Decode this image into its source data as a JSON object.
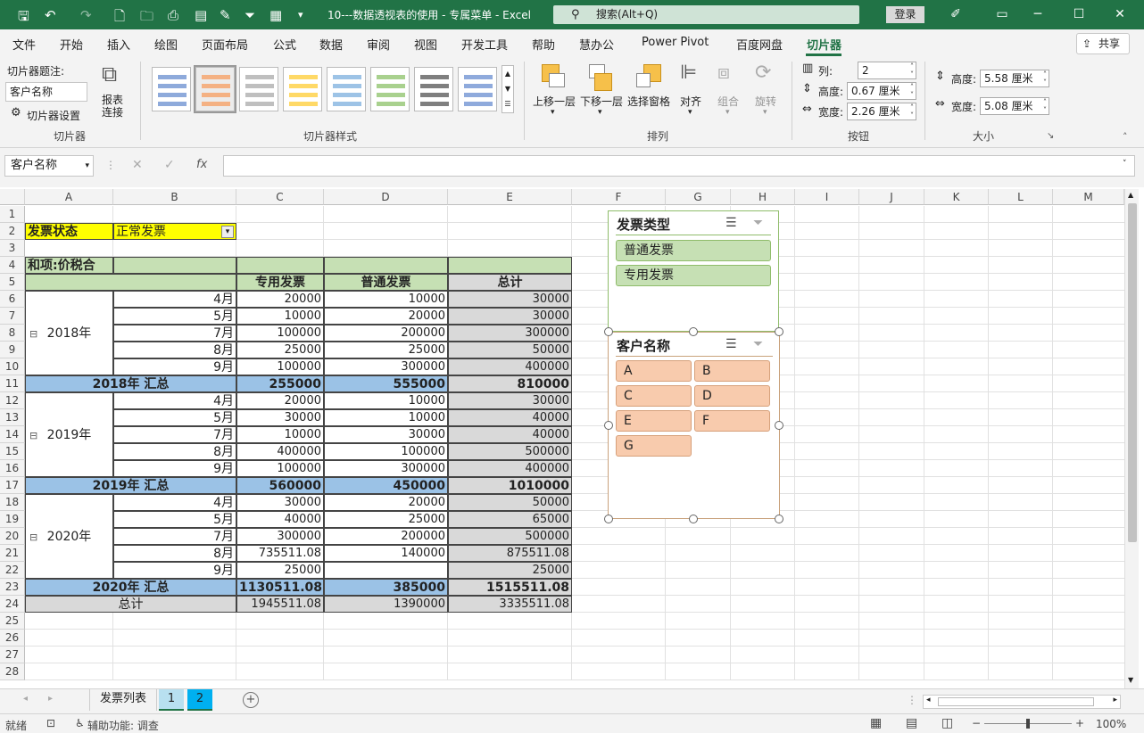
{
  "titlebar": {
    "doc_title": "10---数据透视表的使用 - 专属菜单  -  Excel",
    "search_placeholder": "搜索(Alt+Q)",
    "login": "登录"
  },
  "menu": {
    "tabs": [
      "文件",
      "开始",
      "插入",
      "绘图",
      "页面布局",
      "公式",
      "数据",
      "审阅",
      "视图",
      "开发工具",
      "帮助",
      "慧办公",
      "Power Pivot",
      "百度网盘",
      "切片器"
    ],
    "active_tab": "切片器",
    "share": "共享"
  },
  "ribbon": {
    "caption_label": "切片器题注:",
    "caption_value": "客户名称",
    "settings": "切片器设置",
    "report_link": "报表\n连接",
    "group_slicer": "切片器",
    "group_styles": "切片器样式",
    "bring_forward": "上移一层",
    "send_backward": "下移一层",
    "selection_pane": "选择窗格",
    "align": "对齐",
    "group": "组合",
    "rotate": "旋转",
    "group_arrange": "排列",
    "columns_label": "列:",
    "columns_value": "2",
    "btn_height_label": "高度:",
    "btn_height_value": "0.67 厘米",
    "btn_width_label": "宽度:",
    "btn_width_value": "2.26 厘米",
    "group_buttons": "按钮",
    "size_height_label": "高度:",
    "size_height_value": "5.58 厘米",
    "size_width_label": "宽度:",
    "size_width_value": "5.08 厘米",
    "group_size": "大小"
  },
  "formula": {
    "name_box": "客户名称",
    "fx": "fx"
  },
  "columns": [
    "A",
    "B",
    "C",
    "D",
    "E",
    "F",
    "G",
    "H",
    "I",
    "J",
    "K",
    "L",
    "M"
  ],
  "rows": [
    "1",
    "2",
    "3",
    "4",
    "5",
    "6",
    "7",
    "8",
    "9",
    "10",
    "11",
    "12",
    "13",
    "14",
    "15",
    "16",
    "17",
    "18",
    "19",
    "20",
    "21",
    "22",
    "23",
    "24",
    "25",
    "26",
    "27",
    "28"
  ],
  "pivot": {
    "filter_label": "发票状态",
    "filter_value": "正常发票",
    "values_label": "和项:价税合",
    "col_special": "专用发票",
    "col_normal": "普通发票",
    "col_total": "总计",
    "years": [
      {
        "year": "2018年",
        "months": [
          [
            "4月",
            "20000",
            "10000",
            "30000"
          ],
          [
            "5月",
            "10000",
            "20000",
            "30000"
          ],
          [
            "7月",
            "100000",
            "200000",
            "300000"
          ],
          [
            "8月",
            "25000",
            "25000",
            "50000"
          ],
          [
            "9月",
            "100000",
            "300000",
            "400000"
          ]
        ],
        "subtotal": [
          "2018年 汇总",
          "255000",
          "555000",
          "810000"
        ]
      },
      {
        "year": "2019年",
        "months": [
          [
            "4月",
            "20000",
            "10000",
            "30000"
          ],
          [
            "5月",
            "30000",
            "10000",
            "40000"
          ],
          [
            "7月",
            "10000",
            "30000",
            "40000"
          ],
          [
            "8月",
            "400000",
            "100000",
            "500000"
          ],
          [
            "9月",
            "100000",
            "300000",
            "400000"
          ]
        ],
        "subtotal": [
          "2019年 汇总",
          "560000",
          "450000",
          "1010000"
        ]
      },
      {
        "year": "2020年",
        "months": [
          [
            "4月",
            "30000",
            "20000",
            "50000"
          ],
          [
            "5月",
            "40000",
            "25000",
            "65000"
          ],
          [
            "7月",
            "300000",
            "200000",
            "500000"
          ],
          [
            "8月",
            "735511.08",
            "140000",
            "875511.08"
          ],
          [
            "9月",
            "25000",
            "",
            "25000"
          ]
        ],
        "subtotal": [
          "2020年 汇总",
          "1130511.08",
          "385000",
          "1515511.08"
        ]
      }
    ],
    "grand_total": [
      "总计",
      "1945511.08",
      "1390000",
      "3335511.08"
    ]
  },
  "slicer_invoice": {
    "title": "发票类型",
    "items": [
      "普通发票",
      "专用发票"
    ]
  },
  "slicer_customer": {
    "title": "客户名称",
    "items": [
      "A",
      "B",
      "C",
      "D",
      "E",
      "F",
      "G"
    ]
  },
  "sheets": {
    "tabs": [
      "发票列表",
      "1",
      "2"
    ],
    "active": "2"
  },
  "status": {
    "ready": "就绪",
    "accessibility": "辅助功能: 调查",
    "zoom": "100%"
  },
  "colors": {
    "excel_green": "#217346",
    "pivot_header": "#c6e0b4",
    "subtotal_blue": "#9bc2e6",
    "total_gray": "#d9d9d9",
    "filter_yellow": "#ffff00",
    "slicer1_item": "#c6e0b4",
    "slicer2_item": "#f8cbad"
  }
}
